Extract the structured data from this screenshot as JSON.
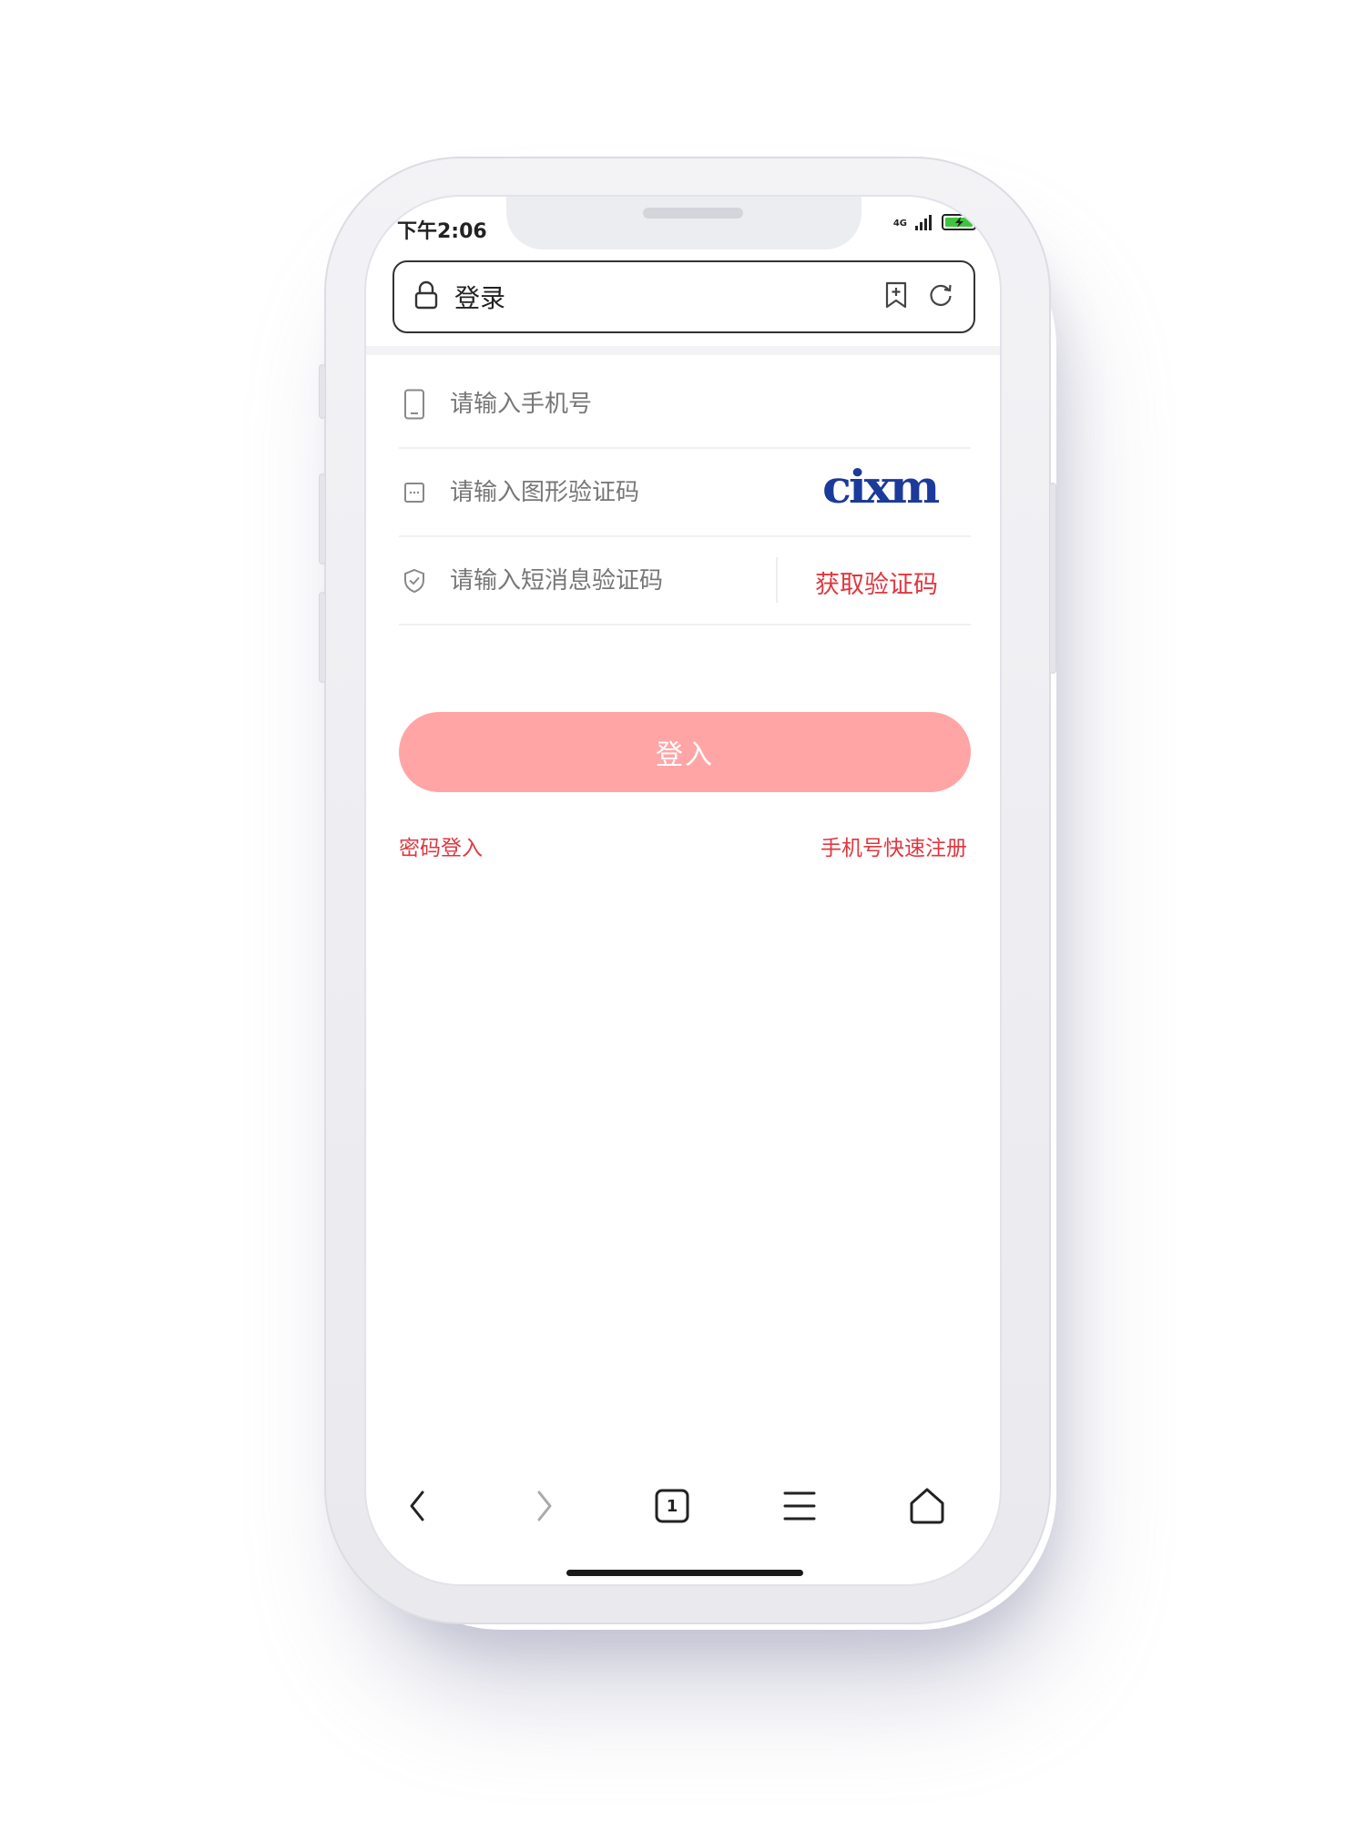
{
  "status_bar": {
    "time": "下午2:06",
    "network": "4G"
  },
  "address_bar": {
    "title": "登录",
    "icons": [
      "lock-icon",
      "bookmark-add-icon",
      "refresh-icon"
    ]
  },
  "form": {
    "phone_placeholder": "请输入手机号",
    "captcha_placeholder": "请输入图形验证码",
    "captcha_text": "cixm",
    "sms_placeholder": "请输入短消息验证码",
    "get_code_label": "获取验证码",
    "login_label": "登入",
    "password_login_label": "密码登入",
    "quick_register_label": "手机号快速注册"
  },
  "bottom_nav": {
    "tab_count": "1",
    "icons": [
      "back-icon",
      "forward-icon",
      "tabs-icon",
      "menu-icon",
      "home-icon"
    ]
  },
  "colors": {
    "accent": "#e0373f",
    "login_button": "#ffa5a5",
    "captcha": "#1c3a9a"
  }
}
